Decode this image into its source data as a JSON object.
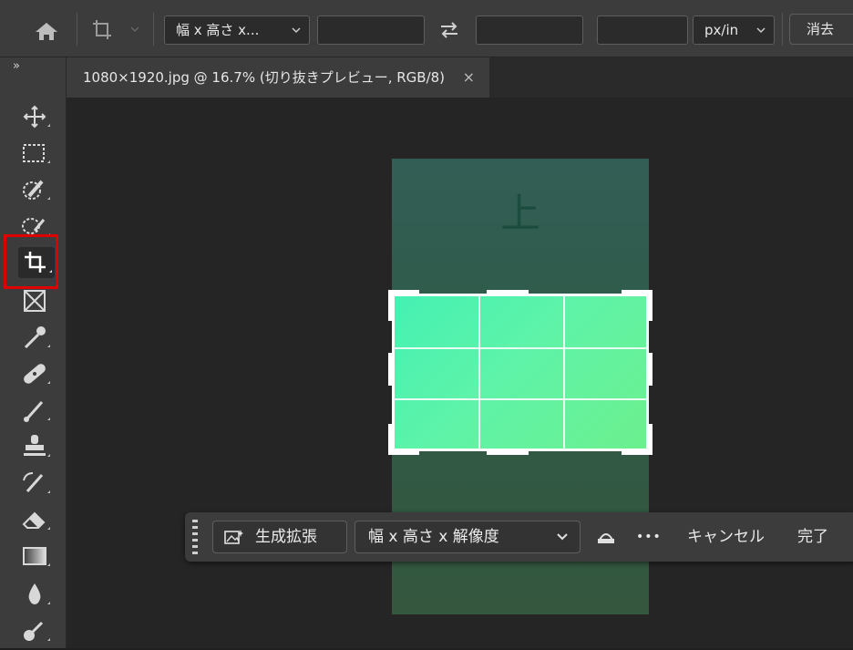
{
  "options_bar": {
    "ratio_select": "幅 x 高さ x...",
    "unit_select": "px/in",
    "clear_button": "消去"
  },
  "toolbar": {
    "collapse": "»",
    "tools": [
      "move",
      "marquee",
      "quick-selection",
      "lasso",
      "crop",
      "frame",
      "eyedropper",
      "healing-brush",
      "brush",
      "clone-stamp",
      "history-brush",
      "eraser",
      "gradient",
      "blur",
      "dodge"
    ],
    "active_tool": "crop",
    "highlight_color": "#e00000"
  },
  "document": {
    "tab_title": "1080×1920.jpg @ 16.7% (切り抜きプレビュー, RGB/8)",
    "tab_close": "×",
    "canvas_text": "上"
  },
  "contextual_taskbar": {
    "generative_expand": "生成拡張",
    "preset": "幅 x 高さ x 解像度",
    "more": "•••",
    "cancel": "キャンセル",
    "done": "完了"
  }
}
